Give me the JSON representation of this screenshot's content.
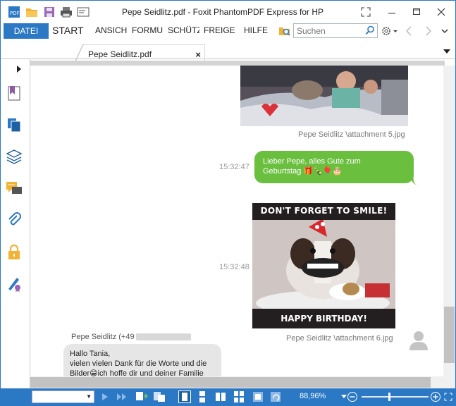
{
  "window": {
    "title": "Pepe Seidlitz.pdf - Foxit PhantomPDF Express for HP"
  },
  "quick_access": [
    "pdf-logo-icon",
    "open-folder-icon",
    "save-icon",
    "print-icon",
    "window-icon"
  ],
  "ribbon": {
    "tabs": [
      "DATEI",
      "START",
      "ANSICHT",
      "FORMULAR",
      "SCHÜTZEN",
      "FREIGEBEN",
      "HILFE"
    ],
    "search_placeholder": "Suchen"
  },
  "document_tab": {
    "label": "Pepe Seidlitz.pdf",
    "close": "×"
  },
  "left_panel": {
    "icons": [
      "bookmark-icon",
      "pages-icon",
      "layers-icon",
      "comments-icon",
      "attachment-icon",
      "security-icon",
      "signature-icon"
    ]
  },
  "chat": {
    "attachment5_caption": "Pepe Seidlitz \\attachment 5.jpg",
    "time1": "15:32:47",
    "green_line1": "Lieber Pepe, alles Gute zum",
    "green_line2": "Geburtstag 🎁🍾🎈🎂",
    "meme_top": "DON'T FORGET TO SMILE!",
    "meme_bottom": "HAPPY BIRTHDAY!",
    "time2": "15:32:48",
    "attachment6_caption": "Pepe Seidlitz \\attachment 6.jpg",
    "sender": "Pepe Seidlitz (+49",
    "grey_line1": "Hallo Tania,",
    "grey_line2": "vielen vielen Dank für die Worte und die",
    "grey_line3": "Bilder😁ich hoffe dir und deiner Familie"
  },
  "statusbar": {
    "zoom": "88,96%"
  },
  "colors": {
    "accent": "#2b78c5",
    "green_bubble": "#6bbf3f",
    "grey_bubble": "#e6e6e6"
  }
}
